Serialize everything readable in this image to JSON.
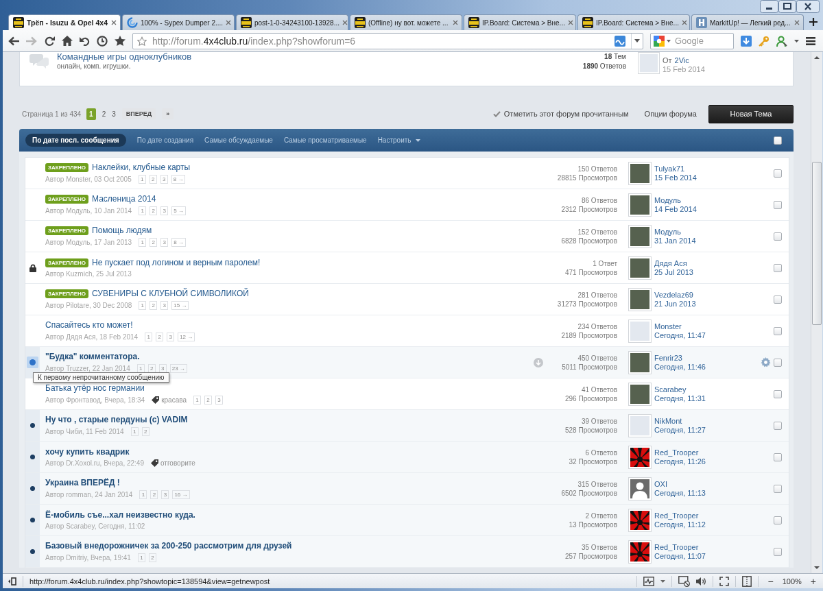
{
  "tabs": [
    {
      "title": "Трёп - Isuzu & Opel 4x4",
      "selected": true,
      "kind": "club"
    },
    {
      "title": "100% - Sypex Dumper 2....",
      "selected": false,
      "kind": "swirl"
    },
    {
      "title": "post-1-0-34243100-13928...",
      "selected": false,
      "kind": "club"
    },
    {
      "title": "(Offline) ну вот. можете ...",
      "selected": false,
      "kind": "club"
    },
    {
      "title": "IP.Board: Система > Вне...",
      "selected": false,
      "kind": "club"
    },
    {
      "title": "IP.Board: Система > Вне...",
      "selected": false,
      "kind": "club"
    },
    {
      "title": "MarkitUp! — Легкий ред...",
      "selected": false,
      "kind": "tile"
    }
  ],
  "navigation": {
    "back": {
      "disabled": false
    },
    "forward": {
      "disabled": true
    }
  },
  "address_bar": {
    "url_start": "http://forum.",
    "url_domain": "4x4club.ru",
    "url_end": "/index.php?showforum=6"
  },
  "search_bar": {
    "placeholder": "Google"
  },
  "forum": {
    "title": "Командные игры одноклубников",
    "description": "онлайн, комп. игрушки.",
    "topics": "**18** Тем",
    "replies": "**1890** Ответов",
    "last_post": {
      "by_label": "От",
      "author": "2Vic",
      "date": "15 Feb 2014",
      "avatar": {
        "kind": "picture"
      }
    }
  },
  "pagination": {
    "summary": "Страница 1 из 434",
    "pages": [
      {
        "label": "1",
        "selected": true
      },
      {
        "label": "2",
        "selected": false
      },
      {
        "label": "3",
        "selected": false
      }
    ],
    "next": "ВПЕРЕД",
    "last": "»"
  },
  "forum_actions": {
    "mark_read": "Отметить этот форум прочитанным",
    "options": "Опции форума",
    "new_topic": "Новая Тема"
  },
  "sort_bar": {
    "items": [
      {
        "label": "По дате посл. сообщения",
        "selected": true,
        "kind": "sort"
      },
      {
        "label": "По дате создания",
        "selected": false,
        "kind": "sort"
      },
      {
        "label": "Самые обсуждаемые",
        "selected": false,
        "kind": "sort"
      },
      {
        "label": "Самые просматриваемые",
        "selected": false,
        "kind": "sort"
      },
      {
        "label": "Настроить",
        "selected": false,
        "kind": "menu"
      }
    ],
    "select_all": {
      "checked": false
    }
  },
  "topics": [
    {
      "badge": "ЗАКРЕПЛЕНО",
      "title": "Наклейки, клубные карты",
      "author": "Автор Monster, 03 Oct 2005",
      "pages": [
        "1",
        "2",
        "3",
        "8 →"
      ],
      "replies": "150 Ответов",
      "views": "28815 Просмотров",
      "poster": "Tulyak71",
      "date": "15 Feb 2014",
      "avatar": {
        "kind": "photo"
      },
      "unread": false,
      "locked": false,
      "highlighted": false,
      "checked": false
    },
    {
      "badge": "ЗАКРЕПЛЕНО",
      "title": "Масленица 2014",
      "author": "Автор Модуль, 10 Jan 2014",
      "pages": [
        "1",
        "2",
        "3",
        "5 →"
      ],
      "replies": "86 Ответов",
      "views": "2312 Просмотров",
      "poster": "Модуль",
      "date": "14 Feb 2014",
      "avatar": {
        "kind": "photo"
      },
      "unread": false,
      "locked": false,
      "highlighted": false,
      "checked": false
    },
    {
      "badge": "ЗАКРЕПЛЕНО",
      "title": "Помощь людям",
      "author": "Автор Модуль, 17 Jan 2013",
      "pages": [
        "1",
        "2",
        "3",
        "8 →"
      ],
      "replies": "152 Ответов",
      "views": "6828 Просмотров",
      "poster": "Модуль",
      "date": "31 Jan 2014",
      "avatar": {
        "kind": "photo"
      },
      "unread": false,
      "locked": false,
      "highlighted": false,
      "checked": false
    },
    {
      "badge": "ЗАКРЕПЛЕНО",
      "title": "Не пускает под логином и верным паролем!",
      "author": "Автор Kuzmich, 25 Jul 2013",
      "replies": "1 Ответ",
      "views": "471 Просмотров",
      "poster": "Дядя Ася",
      "date": "25 Jul 2013",
      "avatar": {
        "kind": "photo"
      },
      "unread": false,
      "locked": true,
      "highlighted": false,
      "checked": false
    },
    {
      "badge": "ЗАКРЕПЛЕНО",
      "title": "СУВЕНИРЫ С КЛУБНОЙ СИМВОЛИКОЙ",
      "author": "Автор Pilotare, 30 Dec 2008",
      "pages": [
        "1",
        "2",
        "3",
        "15 →"
      ],
      "replies": "281 Ответов",
      "views": "31273 Просмотров",
      "poster": "Vezdelaz69",
      "date": "21 Jun 2013",
      "avatar": {
        "kind": "photo"
      },
      "unread": false,
      "locked": false,
      "highlighted": false,
      "checked": false
    },
    {
      "title": "Спасайтесь кто может!",
      "author": "Автор Дядя Ася, 18 Feb 2014",
      "pages": [
        "1",
        "2",
        "3",
        "12 →"
      ],
      "replies": "234 Ответов",
      "views": "2189 Просмотров",
      "poster": "Monster",
      "date": "Сегодня, 11:47",
      "avatar": {
        "kind": "picture"
      },
      "unread": false,
      "locked": false,
      "highlighted": false,
      "checked": false
    },
    {
      "title": "\"Будка\" комментатора.",
      "author": "Автор Truzzer, 22 Jan 2014",
      "pages": [
        "1",
        "2",
        "3",
        "23 →"
      ],
      "replies": "450 Ответов",
      "views": "5011 Просмотров",
      "poster": "Fenrir23",
      "date": "Сегодня, 11:46",
      "avatar": {
        "kind": "photo"
      },
      "unread": true,
      "locked": false,
      "highlighted": true,
      "checked": false,
      "tooltip": "К первому непрочитанному сообщению"
    },
    {
      "title": "Батька утёр нос германии",
      "author": "Автор Фронтавод, Вчера, 18:34",
      "tag": "красава",
      "pages": [
        "1",
        "2",
        "3"
      ],
      "replies": "41 Ответов",
      "views": "296 Просмотров",
      "poster": "Scarabey",
      "date": "Сегодня, 11:31",
      "avatar": {
        "kind": "photo"
      },
      "unread": false,
      "locked": false,
      "highlighted": false,
      "checked": false
    },
    {
      "title": "Ну что , старые пердуны (с) VADIM",
      "author": "Автор Чиби, 11 Feb 2014",
      "pages": [
        "1",
        "2"
      ],
      "replies": "39 Ответов",
      "views": "528 Просмотров",
      "poster": "NikMont",
      "date": "Сегодня, 11:27",
      "avatar": {
        "kind": "picture"
      },
      "unread": true,
      "locked": false,
      "highlighted": false,
      "checked": false
    },
    {
      "title": "хочу купить квадрик",
      "author": "Автор Dr.Xoxol.ru, Вчера, 22:49",
      "tag": "отговорите",
      "replies": "6 Ответов",
      "views": "32 Просмотров",
      "poster": "Red_Trooper",
      "date": "Сегодня, 11:26",
      "avatar": {
        "kind": "emblem"
      },
      "unread": true,
      "locked": false,
      "highlighted": false,
      "checked": false
    },
    {
      "title": "Украина ВПЕРЁД !",
      "author": "Автор romman, 24 Jan 2014",
      "pages": [
        "1",
        "2",
        "3",
        "16 →"
      ],
      "replies": "315 Ответов",
      "views": "6502 Просмотров",
      "poster": "OXI",
      "date": "Сегодня, 11:13",
      "avatar": {
        "kind": "silhouette"
      },
      "unread": true,
      "locked": false,
      "highlighted": false,
      "checked": false
    },
    {
      "title": "Ё-мобиль съе...хал неизвестно куда.",
      "author": "Автор Scarabey, Сегодня, 11:02",
      "replies": "2 Ответов",
      "views": "13 Просмотров",
      "poster": "Red_Trooper",
      "date": "Сегодня, 11:12",
      "avatar": {
        "kind": "emblem"
      },
      "unread": true,
      "locked": false,
      "highlighted": false,
      "checked": false
    },
    {
      "title": "Базовый внедорожничек за 200-250 рассмотрим для друзей",
      "author": "Автор Dmitriy, Вчера, 19:41",
      "pages": [
        "1",
        "2"
      ],
      "replies": "35 Ответов",
      "views": "257 Просмотров",
      "poster": "Red_Trooper",
      "date": "Сегодня, 11:07",
      "avatar": {
        "kind": "emblem"
      },
      "unread": true,
      "locked": false,
      "highlighted": false,
      "checked": false
    }
  ],
  "status_bar": {
    "url": "http://forum.4x4club.ru/index.php?showtopic=138594&view=getnewpost",
    "zoom_out": "−",
    "zoom": "100%",
    "zoom_in": "+"
  }
}
